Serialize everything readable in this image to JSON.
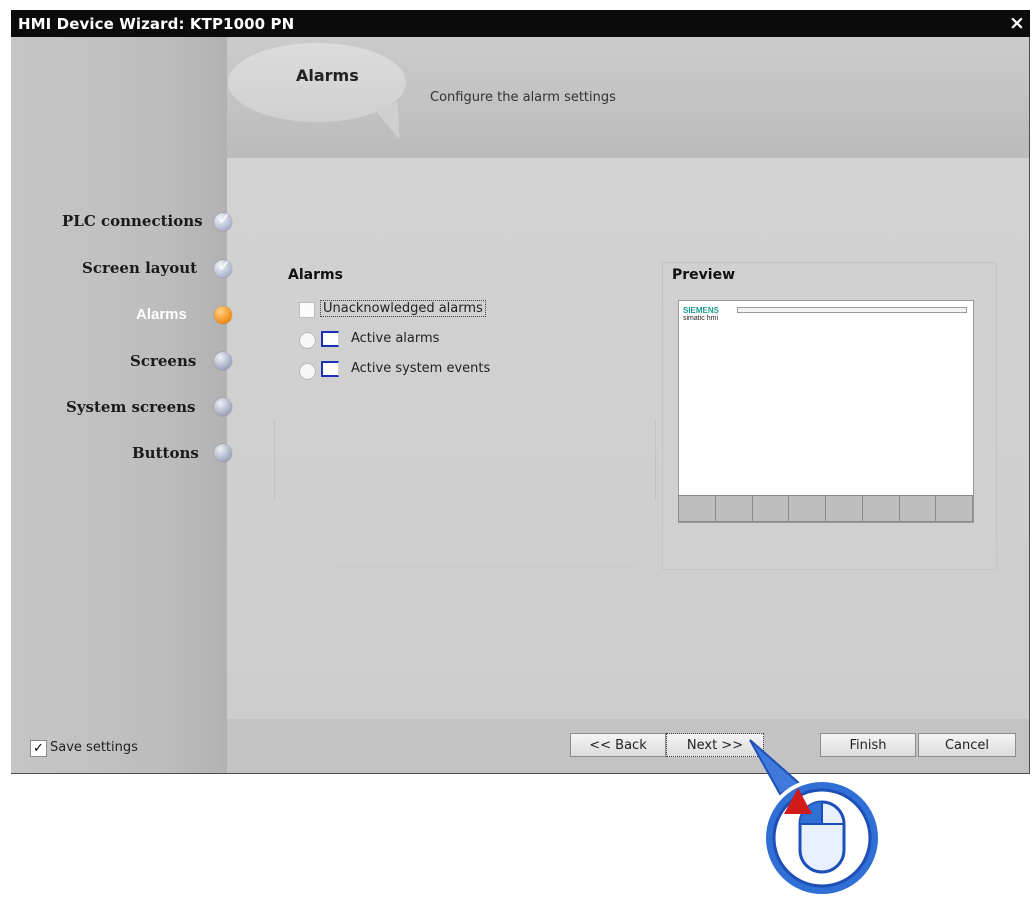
{
  "window": {
    "title": "HMI Device Wizard: KTP1000 PN",
    "close_glyph": "×"
  },
  "header": {
    "title": "Alarms",
    "description": "Configure the alarm settings"
  },
  "nav": {
    "items": [
      {
        "label": "PLC connections",
        "state": "done"
      },
      {
        "label": "Screen layout",
        "state": "done"
      },
      {
        "label": "Alarms",
        "state": "active"
      },
      {
        "label": "Screens",
        "state": "pending"
      },
      {
        "label": "System screens",
        "state": "pending"
      },
      {
        "label": "Buttons",
        "state": "pending"
      }
    ]
  },
  "alarms": {
    "title": "Alarms",
    "options": [
      {
        "label": "Unacknowledged alarms"
      },
      {
        "label": "Active alarms"
      },
      {
        "label": "Active system events"
      }
    ]
  },
  "preview": {
    "title": "Preview",
    "brand": "SIEMENS",
    "subbrand": "simatic hmi",
    "function_keys": 8
  },
  "footer": {
    "save_settings": {
      "label": "Save settings",
      "checked": true
    },
    "back_label": "<< Back",
    "next_label": "Next >>",
    "finish_label": "Finish",
    "cancel_label": "Cancel"
  },
  "colors": {
    "accent_orange": "#f08c12",
    "titlebar": "#0b0b0b",
    "icon_blue": "#1c2fb6",
    "cursor_blue": "#1f5fd1",
    "cursor_red": "#d11a1a"
  }
}
